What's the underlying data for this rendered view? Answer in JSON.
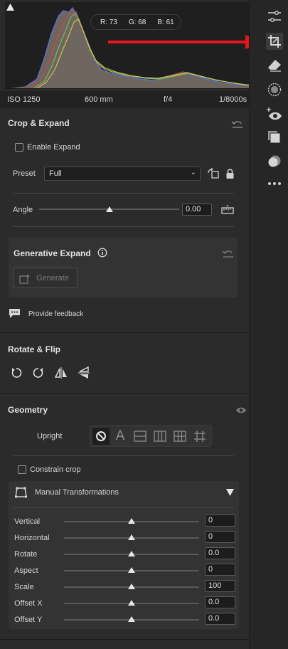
{
  "histogram": {
    "readout": {
      "r": "R: 73",
      "g": "G: 68",
      "b": "B: 61"
    }
  },
  "exif": {
    "iso": "ISO 1250",
    "focal": "600 mm",
    "aperture": "f/4",
    "shutter": "1/8000s"
  },
  "crop": {
    "title": "Crop & Expand",
    "enable_expand": "Enable Expand",
    "preset_label": "Preset",
    "preset_value": "Full",
    "angle_label": "Angle",
    "angle_value": "0.00",
    "angle_level": 0.5
  },
  "gen_expand": {
    "title": "Generative Expand",
    "button": "Generate"
  },
  "feedback": "Provide feedback",
  "rotate": {
    "title": "Rotate & Flip"
  },
  "geometry": {
    "title": "Geometry",
    "upright_label": "Upright",
    "constrain": "Constrain crop",
    "manual_title": "Manual Transformations",
    "sliders": [
      {
        "label": "Vertical",
        "value": "0",
        "level": 0.5
      },
      {
        "label": "Horizontal",
        "value": "0",
        "level": 0.5
      },
      {
        "label": "Rotate",
        "value": "0.0",
        "level": 0.5
      },
      {
        "label": "Aspect",
        "value": "0",
        "level": 0.5
      },
      {
        "label": "Scale",
        "value": "100",
        "level": 0.5
      },
      {
        "label": "Offset X",
        "value": "0.0",
        "level": 0.5
      },
      {
        "label": "Offset Y",
        "value": "0.0",
        "level": 0.5
      }
    ]
  },
  "colors": {
    "annotation_arrow": "#e8161b",
    "panel_bg": "#2b2b2b"
  },
  "toolbar_icons": [
    "edit-sliders-icon",
    "crop-icon",
    "eraser-icon",
    "masking-icon",
    "red-eye-icon",
    "presets-icon",
    "snapshots-icon",
    "more-icon"
  ]
}
